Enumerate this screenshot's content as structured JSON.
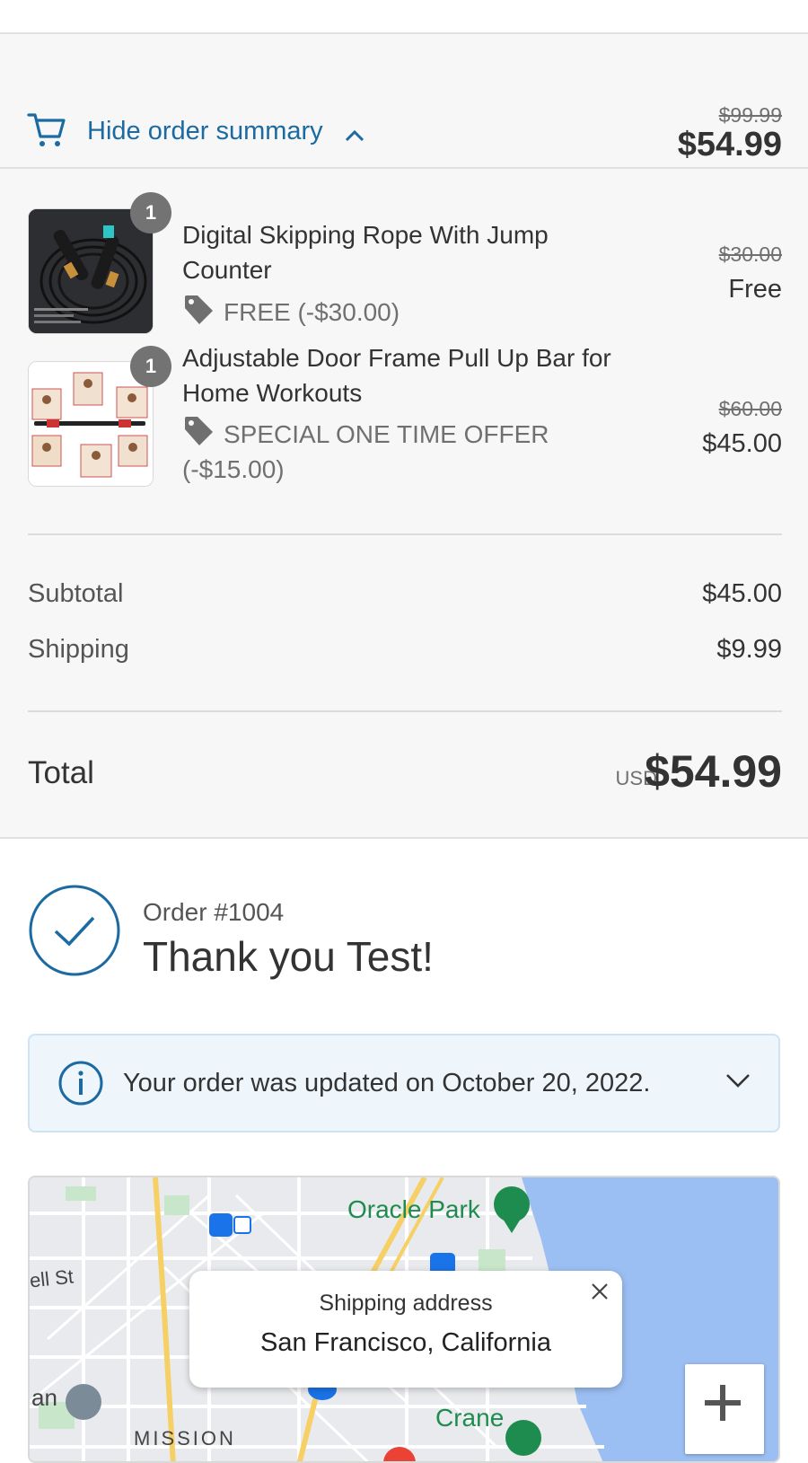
{
  "order_summary_toggle": {
    "label": "Hide order summary",
    "compare_price": "$99.99",
    "price": "$54.99",
    "icons": [
      "cart-icon",
      "chevron-up-icon"
    ]
  },
  "line_items": [
    {
      "title": "Digital Skipping Rope With Jump Counter",
      "quantity": "1",
      "discount": "FREE (-$30.00)",
      "compare_price": "$30.00",
      "price": "Free"
    },
    {
      "title": "Adjustable Door Frame Pull Up Bar for Home Workouts",
      "quantity": "1",
      "discount": "SPECIAL ONE TIME OFFER (-$15.00)",
      "compare_price": "$60.00",
      "price": "$45.00"
    }
  ],
  "totals": {
    "subtotal_label": "Subtotal",
    "subtotal_value": "$45.00",
    "shipping_label": "Shipping",
    "shipping_value": "$9.99",
    "total_label": "Total",
    "currency": "USD",
    "total_value": "$54.99"
  },
  "confirmation": {
    "order_number": "Order #1004",
    "thank_you": "Thank you Test!"
  },
  "notice": {
    "text": "Your order was updated on October 20, 2022."
  },
  "map": {
    "popup_title": "Shipping address",
    "popup_city": "San Francisco, California",
    "labels": {
      "oracle_park": "Oracle Park",
      "crane": "Crane",
      "mission": "MISSION",
      "street_a": "ell St",
      "street_b": "an"
    },
    "zoom_in_label": "+"
  },
  "colors": {
    "link": "#1b6aa1",
    "summary_bg": "#f7f7f7",
    "notice_bg": "#eef6fc",
    "badge": "#737373"
  }
}
